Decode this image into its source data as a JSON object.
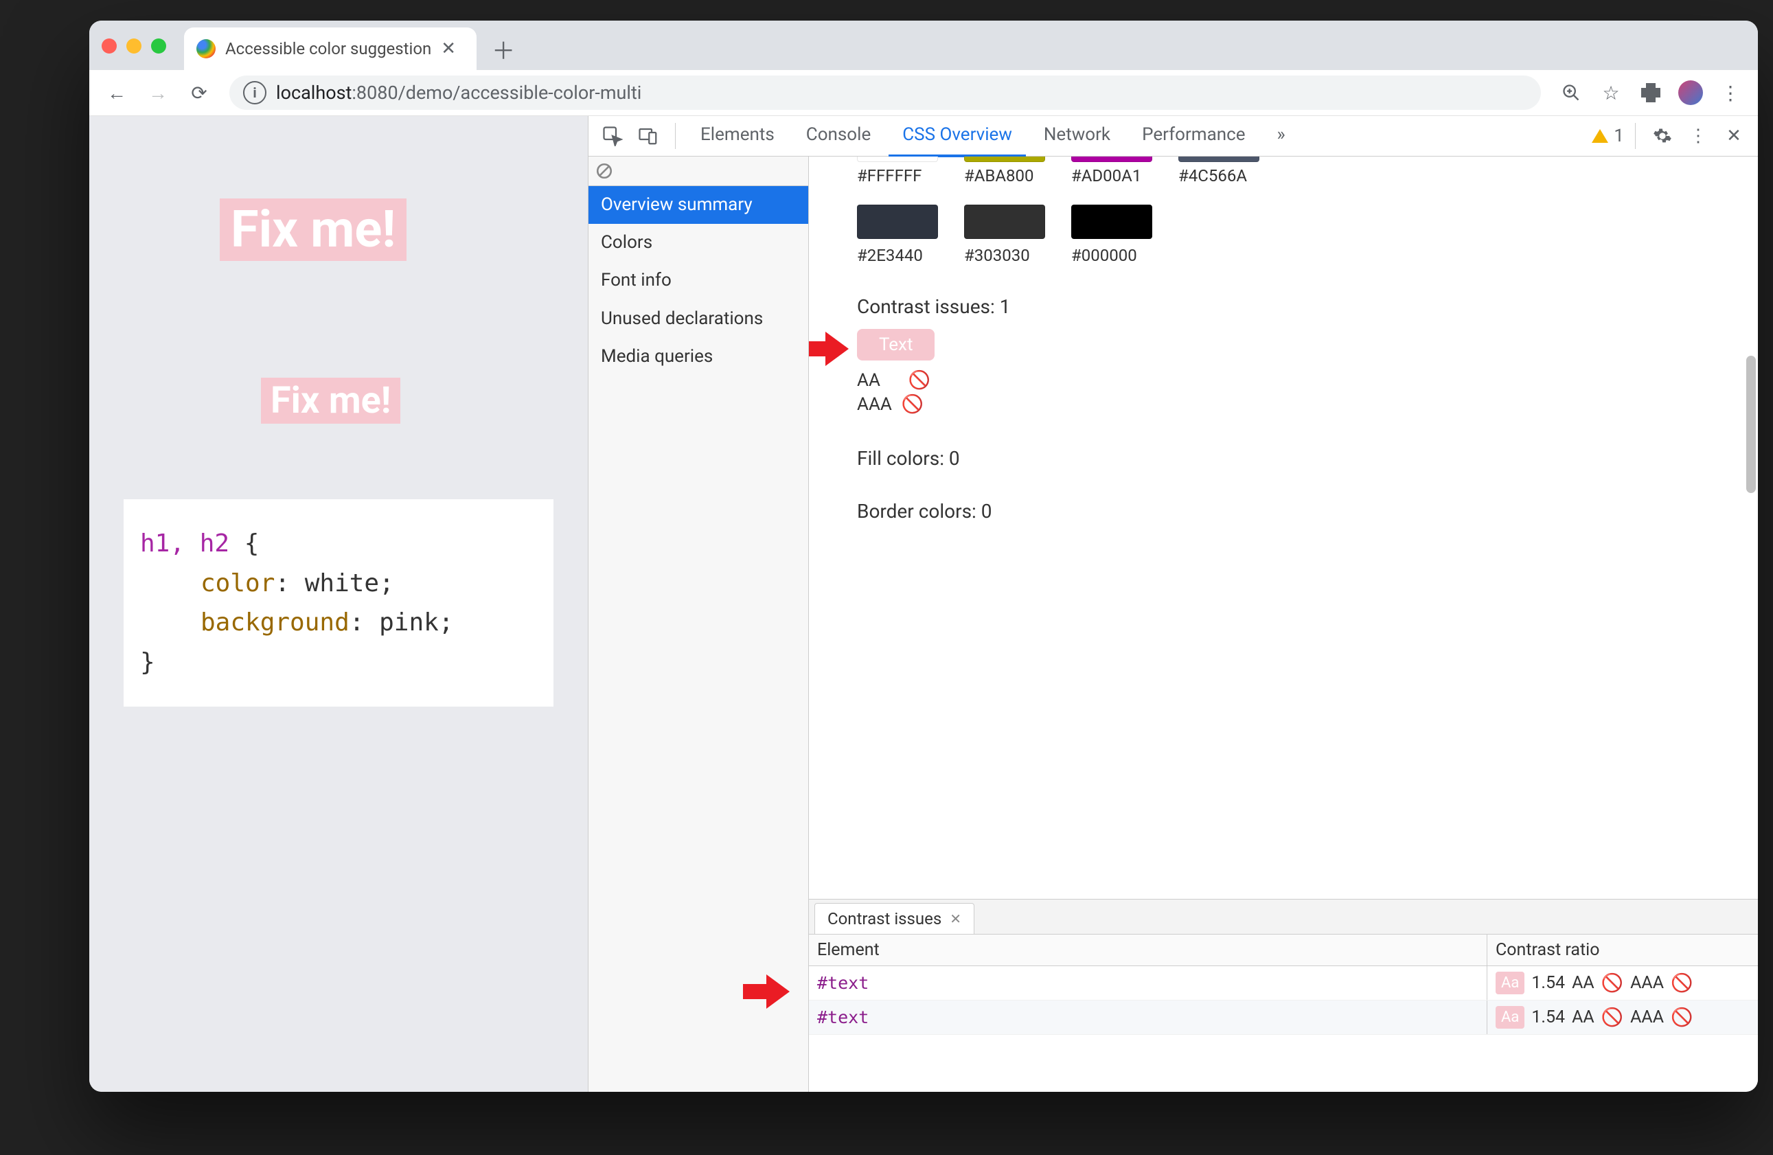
{
  "browser": {
    "tab_title": "Accessible color suggestion",
    "url_prefix": "localhost",
    "url_rest": ":8080/demo/accessible-color-multi"
  },
  "page": {
    "heading1": "Fix me!",
    "heading2": "Fix me!",
    "code": {
      "selector": "h1, h2",
      "open": " {",
      "prop1": "color",
      "val1": ": white;",
      "prop2": "background",
      "val2": ": pink;",
      "close": "}"
    }
  },
  "devtools": {
    "tabs": {
      "elements": "Elements",
      "console": "Console",
      "css_overview": "CSS Overview",
      "network": "Network",
      "performance": "Performance",
      "more": "»"
    },
    "warning_count": "1",
    "sidebar": {
      "overview_summary": "Overview summary",
      "colors": "Colors",
      "font_info": "Font info",
      "unused": "Unused declarations",
      "media": "Media queries"
    },
    "swatches_top": [
      {
        "label": "#FFFFFF",
        "color": "#FFFFFF"
      },
      {
        "label": "#ABA800",
        "color": "#ABA800"
      },
      {
        "label": "#AD00A1",
        "color": "#AD00A1"
      },
      {
        "label": "#4C566A",
        "color": "#4C566A"
      }
    ],
    "swatches_bottom": [
      {
        "label": "#2E3440",
        "color": "#2E3440"
      },
      {
        "label": "#303030",
        "color": "#303030"
      },
      {
        "label": "#000000",
        "color": "#000000"
      }
    ],
    "contrast_heading": "Contrast issues: 1",
    "contrast_swatch_label": "Text",
    "ratings": {
      "aa": "AA",
      "aaa": "AAA"
    },
    "fill_heading": "Fill colors: 0",
    "border_heading": "Border colors: 0",
    "drawer": {
      "tab": "Contrast issues",
      "col_element": "Element",
      "col_ratio": "Contrast ratio",
      "rows": [
        {
          "element": "#text",
          "ratio": "1.54",
          "aa": "AA",
          "aaa": "AAA"
        },
        {
          "element": "#text",
          "ratio": "1.54",
          "aa": "AA",
          "aaa": "AAA"
        }
      ],
      "aa_chip": "Aa"
    }
  }
}
